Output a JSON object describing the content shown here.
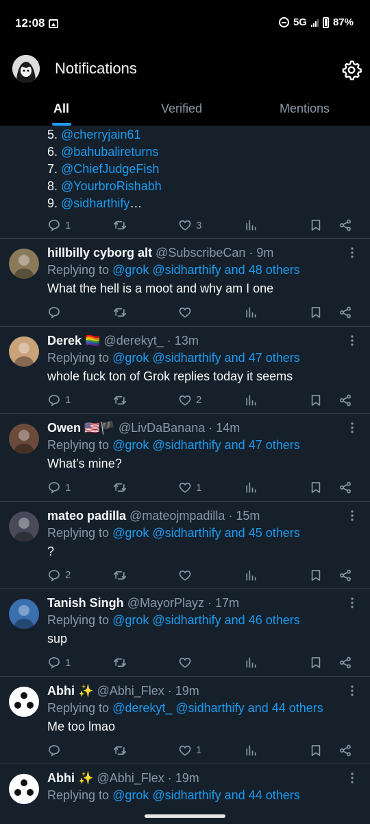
{
  "status": {
    "time": "12:08",
    "network": "5G",
    "battery": "87%"
  },
  "header": {
    "title": "Notifications"
  },
  "tabs": [
    {
      "label": "All",
      "active": true
    },
    {
      "label": "Verified",
      "active": false
    },
    {
      "label": "Mentions",
      "active": false
    }
  ],
  "top_list": {
    "lines": [
      {
        "num": "5.",
        "mention": "@cherryjain61",
        "suffix": ""
      },
      {
        "num": "6.",
        "mention": "@bahubalireturns",
        "suffix": ""
      },
      {
        "num": "7.",
        "mention": "@ChiefJudgeFish",
        "suffix": ""
      },
      {
        "num": "8.",
        "mention": "@YourbroRishabh",
        "suffix": ""
      },
      {
        "num": "9.",
        "mention": "@sidharthify",
        "suffix": "…"
      }
    ],
    "replies": "1",
    "reposts": "",
    "likes": "3"
  },
  "posts": [
    {
      "name": "hillbilly cyborg alt",
      "badge": "",
      "handle": "@SubscribeCan · 9m",
      "reply_prefix": "Replying to ",
      "reply_to": "@grok @sidharthify and 48 others",
      "text": "What the hell is a moot and why am I one",
      "replies": "",
      "reposts": "",
      "likes": "",
      "avatar_color": "#8a7a5a"
    },
    {
      "name": "Derek",
      "badge": "🏳️‍🌈",
      "handle": "@derekyt_ · 13m",
      "reply_prefix": "Replying to ",
      "reply_to": "@grok @sidharthify and 47 others",
      "text": "whole fuck ton of Grok replies today it seems",
      "replies": "1",
      "reposts": "",
      "likes": "2",
      "avatar_color": "#c9a27a"
    },
    {
      "name": "Owen",
      "badge": "🇺🇸🏴",
      "handle": "@LivDaBanana · 14m",
      "reply_prefix": "Replying to ",
      "reply_to": "@grok @sidharthify and 47 others",
      "text": "What’s mine?",
      "replies": "1",
      "reposts": "",
      "likes": "1",
      "avatar_color": "#6b4a3a"
    },
    {
      "name": "mateo padilla",
      "badge": "",
      "handle": "@mateojmpadilla · 15m",
      "reply_prefix": "Replying to ",
      "reply_to": "@grok @sidharthify and 45 others",
      "text": "?",
      "replies": "2",
      "reposts": "",
      "likes": "",
      "avatar_color": "#4a4a5a"
    },
    {
      "name": "Tanish Singh",
      "badge": "",
      "handle": "@MayorPlayz · 17m",
      "reply_prefix": "Replying to ",
      "reply_to": "@grok @sidharthify and 46 others",
      "text": "sup",
      "replies": "1",
      "reposts": "",
      "likes": "",
      "avatar_color": "#3a6fb0"
    },
    {
      "name": "Abhi",
      "badge": "✨",
      "handle": "@Abhi_Flex · 19m",
      "reply_prefix": "Replying to ",
      "reply_to": "@derekyt_ @sidharthify and 44 others",
      "text": "Me too lmao",
      "replies": "",
      "reposts": "",
      "likes": "1",
      "avatar_color": "#ffffff"
    },
    {
      "name": "Abhi",
      "badge": "✨",
      "handle": "@Abhi_Flex · 19m",
      "reply_prefix": "Replying to ",
      "reply_to": "@grok @sidharthify and 44 others",
      "text": "",
      "replies": "",
      "reposts": "",
      "likes": "",
      "avatar_color": "#ffffff"
    }
  ],
  "icons": {
    "settings": "gear-icon",
    "reply": "reply-icon",
    "repost": "repost-icon",
    "like": "heart-icon",
    "views": "views-icon",
    "bookmark": "bookmark-icon",
    "share": "share-icon",
    "more": "more-icon"
  },
  "colors": {
    "accent": "#1d9bf0",
    "background": "#15202b",
    "muted": "#8b98a5"
  }
}
